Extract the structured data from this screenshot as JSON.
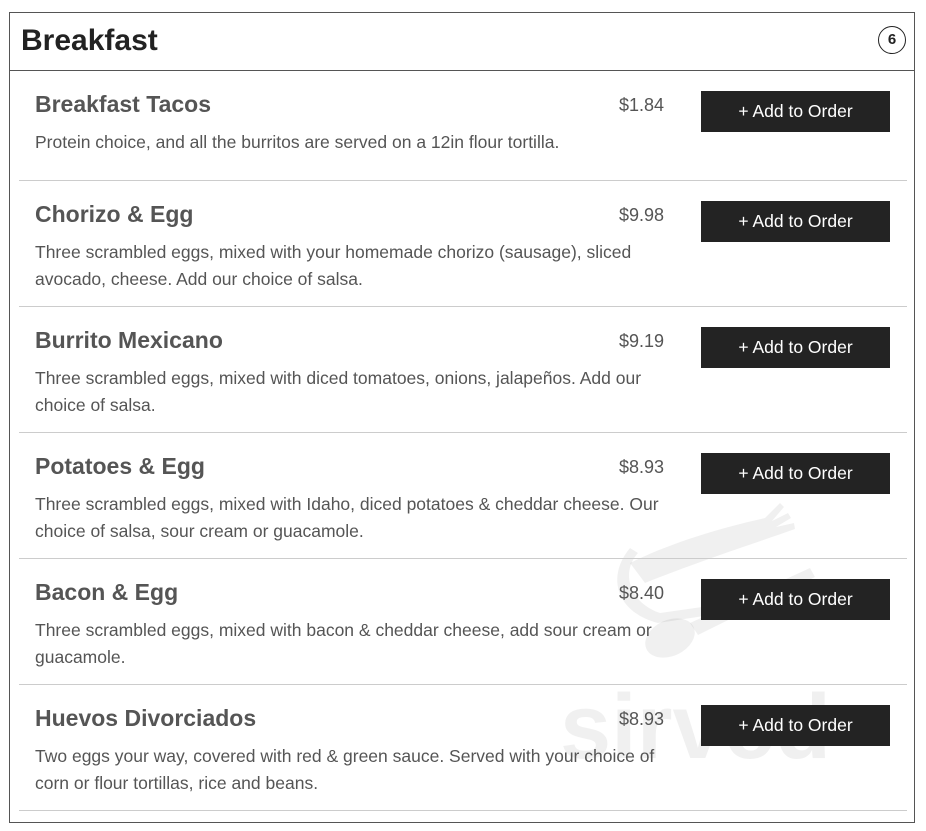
{
  "section": {
    "title": "Breakfast",
    "count": "6"
  },
  "watermark_text": "sirved",
  "items": [
    {
      "name": "Breakfast Tacos",
      "price": "$1.84",
      "description": "Protein choice, and all the burritos are served on a 12in flour tortilla.",
      "button_label": "+ Add to Order"
    },
    {
      "name": "Chorizo & Egg",
      "price": "$9.98",
      "description": "Three scrambled eggs, mixed with your homemade chorizo (sausage), sliced avocado, cheese. Add our choice of salsa.",
      "button_label": "+ Add to Order"
    },
    {
      "name": "Burrito Mexicano",
      "price": "$9.19",
      "description": "Three scrambled eggs, mixed with diced tomatoes, onions, jalapeños. Add our choice of salsa.",
      "button_label": "+ Add to Order"
    },
    {
      "name": "Potatoes & Egg",
      "price": "$8.93",
      "description": "Three scrambled eggs, mixed with Idaho, diced potatoes & cheddar cheese. Our choice of salsa, sour cream or guacamole.",
      "button_label": "+ Add to Order"
    },
    {
      "name": "Bacon & Egg",
      "price": "$8.40",
      "description": "Three scrambled eggs, mixed with bacon & cheddar cheese, add sour cream or guacamole.",
      "button_label": "+ Add to Order"
    },
    {
      "name": "Huevos Divorciados",
      "price": "$8.93",
      "description": "Two eggs your way, covered with red & green sauce. Served with your choice of corn or flour tortillas, rice and beans.",
      "button_label": "+ Add to Order"
    }
  ]
}
